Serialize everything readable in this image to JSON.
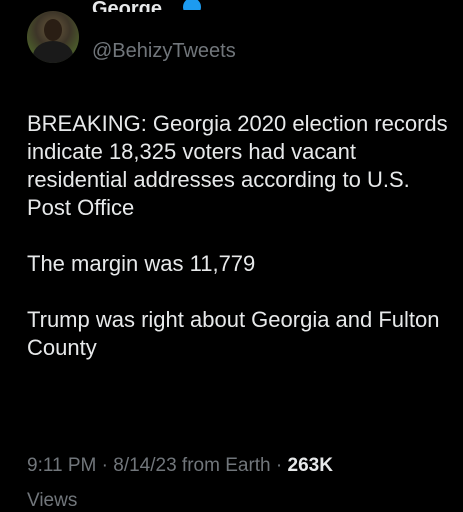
{
  "author": {
    "display_name": "George",
    "handle": "@BehizyTweets"
  },
  "tweet": {
    "paragraphs": [
      "BREAKING: Georgia 2020 election records indicate 18,325 voters had vacant residential addresses according to U.S. Post Office",
      "The margin was 11,779",
      "Trump was right about Georgia and Fulton County"
    ]
  },
  "meta": {
    "time": "9:11 PM",
    "separator": "·",
    "date": "8/14/23 from Earth",
    "views_count": "263K",
    "views_label": "Views"
  },
  "colors": {
    "background": "#000000",
    "text": "#e7e9ea",
    "muted": "#71767b",
    "verified": "#1d9bf0"
  }
}
